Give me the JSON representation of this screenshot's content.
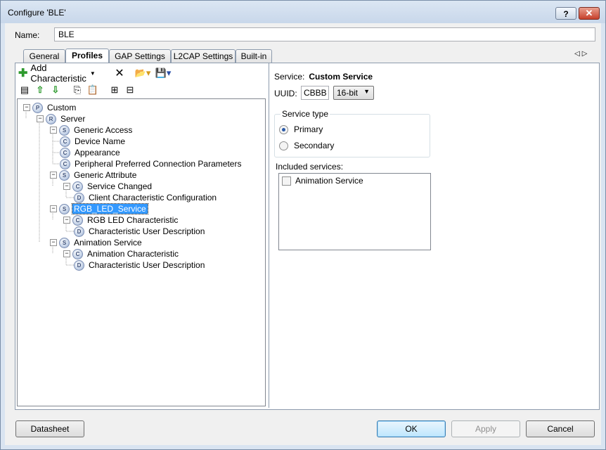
{
  "window": {
    "title": "Configure 'BLE'",
    "help_label": "?",
    "close_label": "✕"
  },
  "name": {
    "label": "Name:",
    "value": "BLE"
  },
  "tabs": [
    {
      "label": "General"
    },
    {
      "label": "Profiles"
    },
    {
      "label": "GAP Settings"
    },
    {
      "label": "L2CAP Settings"
    },
    {
      "label": "Built-in"
    }
  ],
  "toolbar": {
    "add_label": "Add Characteristic"
  },
  "tree": [
    {
      "label": "Custom",
      "badge": "P"
    },
    {
      "label": "Server",
      "badge": "R"
    },
    {
      "label": "Generic Access",
      "badge": "S"
    },
    {
      "label": "Device Name",
      "badge": "C"
    },
    {
      "label": "Appearance",
      "badge": "C"
    },
    {
      "label": "Peripheral Preferred Connection Parameters",
      "badge": "C"
    },
    {
      "label": "Generic Attribute",
      "badge": "S"
    },
    {
      "label": "Service Changed",
      "badge": "C"
    },
    {
      "label": "Client Characteristic Configuration",
      "badge": "D"
    },
    {
      "label": "RGB_LED_Service",
      "badge": "S"
    },
    {
      "label": "RGB LED Characteristic",
      "badge": "C"
    },
    {
      "label": "Characteristic User Description",
      "badge": "D"
    },
    {
      "label": "Animation Service",
      "badge": "S"
    },
    {
      "label": "Animation Characteristic",
      "badge": "C"
    },
    {
      "label": "Characteristic User Description",
      "badge": "D"
    }
  ],
  "details": {
    "service_label": "Service:",
    "service_value": "Custom Service",
    "uuid_label": "UUID:",
    "uuid_value": "CBBB",
    "uuid_size": "16-bit",
    "service_type_label": "Service type",
    "primary_label": "Primary",
    "secondary_label": "Secondary",
    "included_label": "Included services:",
    "included_items": [
      {
        "label": "Animation Service",
        "checked": false
      }
    ]
  },
  "buttons": {
    "datasheet": "Datasheet",
    "ok": "OK",
    "apply": "Apply",
    "cancel": "Cancel"
  }
}
